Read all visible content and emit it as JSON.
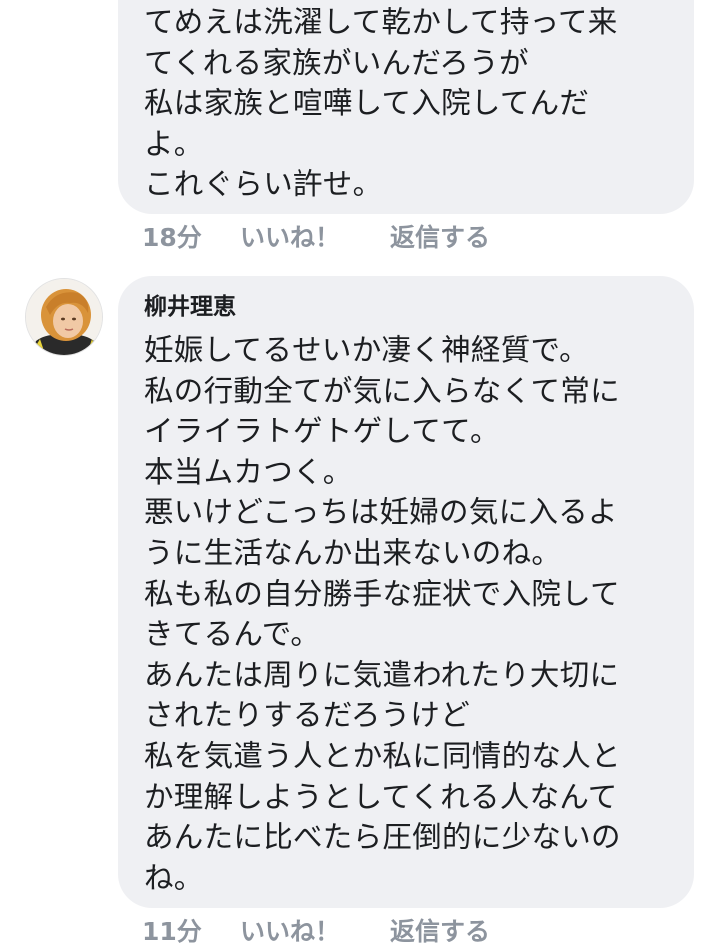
{
  "comments": [
    {
      "lines": [
        "てめえは洗濯して乾かして持って来",
        "てくれる家族がいんだろうが",
        "私は家族と喧嘩して入院してんだ",
        "よ。",
        "これぐらい許せ。"
      ],
      "time": "18分",
      "like_label": "いいね！",
      "reply_label": "返信する"
    },
    {
      "author": "柳井理恵",
      "lines": [
        "妊娠してるせいか凄く神経質で。",
        "私の行動全てが気に入らなくて常に",
        "イライラトゲトゲしてて。",
        "本当ムカつく。",
        "悪いけどこっちは妊婦の気に入るよ",
        "うに生活なんか出来ないのね。",
        "私も私の自分勝手な症状で入院して",
        "きてるんで。",
        "あんたは周りに気遣われたり大切に",
        "されたりするだろうけど",
        "私を気遣う人とか私に同情的な人と",
        "か理解しようとしてくれる人なんて",
        "あんたに比べたら圧倒的に少ないの",
        "ね。"
      ],
      "time": "11分",
      "like_label": "いいね！",
      "reply_label": "返信する"
    }
  ],
  "colors": {
    "bubble_bg": "#eff0f3",
    "text": "#1c1e21",
    "meta": "#8d949e"
  }
}
